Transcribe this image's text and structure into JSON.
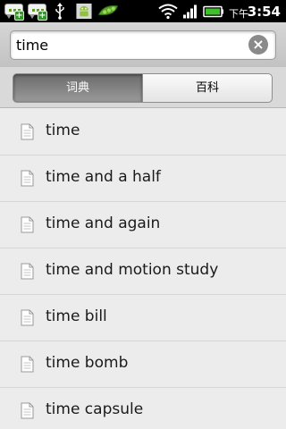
{
  "status_bar": {
    "notifications": [
      "message-icon",
      "message-icon",
      "usb-icon",
      "android-debug-icon",
      "pea-pod-icon"
    ],
    "indicators": [
      "wifi-icon",
      "signal-icon",
      "battery-icon"
    ],
    "ampm": "下午",
    "time": "3:54"
  },
  "search": {
    "value": "time",
    "clear_icon": "clear-icon"
  },
  "tabs": [
    {
      "label": "词典",
      "active": true
    },
    {
      "label": "百科",
      "active": false
    }
  ],
  "results": [
    {
      "label": "time"
    },
    {
      "label": "time and a half"
    },
    {
      "label": "time and again"
    },
    {
      "label": "time and motion study"
    },
    {
      "label": "time bill"
    },
    {
      "label": "time bomb"
    },
    {
      "label": "time capsule"
    }
  ]
}
